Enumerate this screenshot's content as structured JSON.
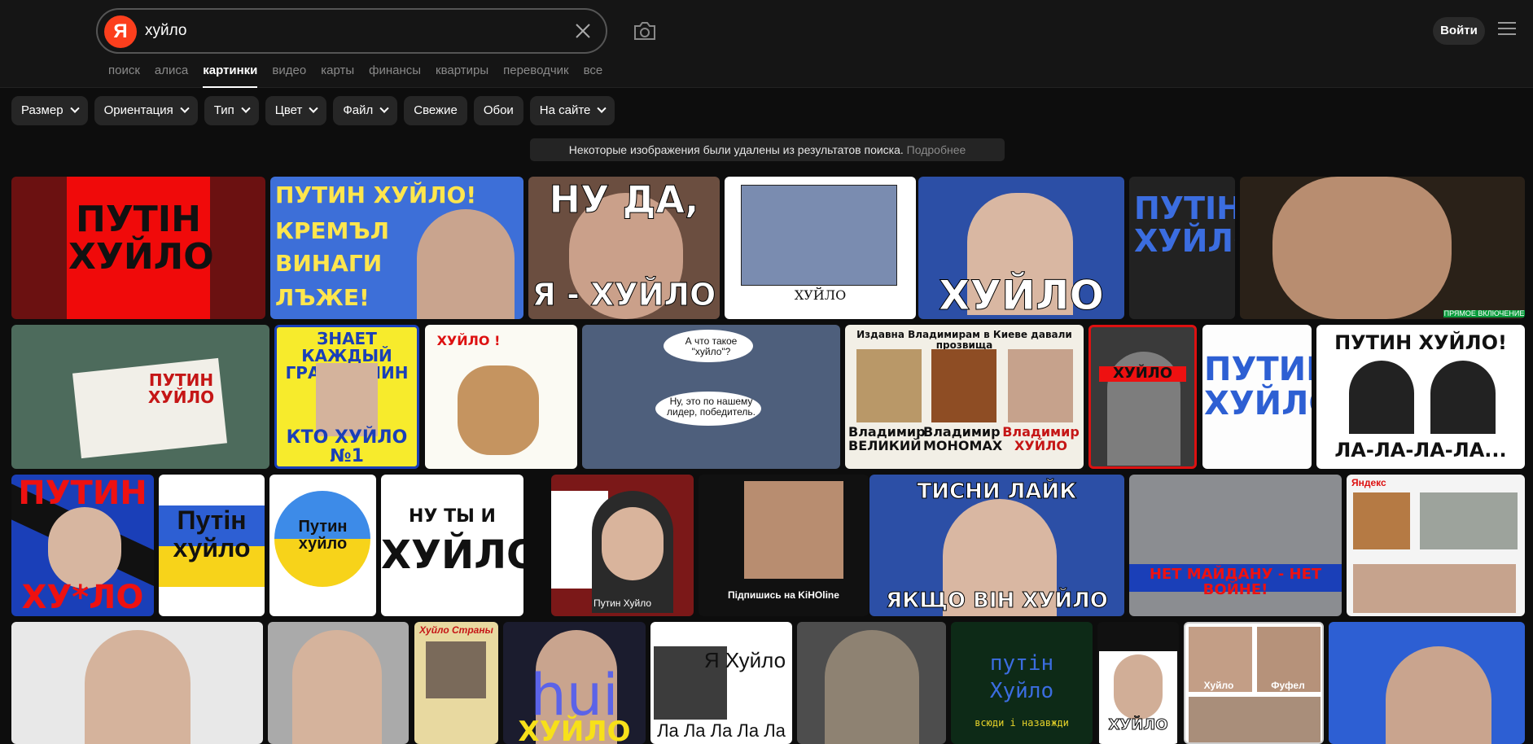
{
  "search": {
    "logo": "Я",
    "query": "хуйло",
    "clear_icon": "close-icon",
    "camera_icon": "camera-icon"
  },
  "header": {
    "login_label": "Войти",
    "menu_icon": "hamburger-icon"
  },
  "nav": {
    "items": [
      "поиск",
      "алиса",
      "картинки",
      "видео",
      "карты",
      "финансы",
      "квартиры",
      "переводчик",
      "все"
    ],
    "active": "картинки"
  },
  "filters": [
    "Размер",
    "Ориентация",
    "Тип",
    "Цвет",
    "Файл",
    "Свежие",
    "Обои",
    "На сайте"
  ],
  "notice": {
    "text": "Некоторые изображения были удалены из результатов поиска.",
    "link": "Подробнее"
  },
  "tiles": {
    "r1": {
      "a": "ПУТІН ХУЙЛО",
      "b1": "ПУТИН ХУЙЛО!",
      "b2": "КРЕМЪЛ",
      "b3": "ВИНАГИ",
      "b4": "ЛЪЖЕ!",
      "c1": "НУ ДА,",
      "c2": "Я - ХУЙЛО",
      "d": "ХУЙЛО",
      "e": "ХУЙЛО",
      "f": "ПУТІН ХУЙЛО",
      "g": "ПРЯМОЕ ВКЛЮЧЕНИЕ"
    },
    "r2": {
      "a": "ПУТИН ХУЙЛО",
      "b1": "ЗНАЕТ КАЖДЫЙ ГРАЖДАНИН",
      "b2": "КТО ХУЙЛО №1",
      "c": "ХУЙЛО !",
      "d1": "А что такое \"хуйло\"?",
      "d2": "Ну, это по нашему лидер, победитель.",
      "e1": "Издавна Владимирам в Киеве давали прозвища",
      "e2": "Владимир ВЕЛИКИЙ",
      "e3": "Владимир МОНОМАХ",
      "e4": "Владимир ХУЙЛО",
      "f": "ХУЙЛО",
      "g": "ПУТИН ХУЙЛО",
      "h1": "ПУТИН ХУЙЛО!",
      "h2": "ЛА-ЛА-ЛА-ЛА..."
    },
    "r3": {
      "a1": "ПУТИН",
      "a2": "ХУ*ЛО",
      "b": "Путін хуйло",
      "c": "Путин хуйло",
      "d1": "НУ ТЫ И",
      "d2": "ХУЙЛО",
      "e": "Путин Хуйло",
      "f": "Підпишись на KiHOline",
      "g1": "ТИСНИ ЛАЙК",
      "g2": "ЯКЩО ВІН ХУЙЛО",
      "h": "НЕТ МАЙДАНУ - НЕТ ВОЙНЕ!",
      "i": "Яндекс"
    },
    "r4": {
      "a": "Хуйло Страны",
      "b1": "hui",
      "b2": "ХУЙЛО",
      "c1": "Я Хуйло",
      "c2": "Ла Ла Ла Ла Ла",
      "d1": "путін",
      "d2": "Хуйло",
      "d3": "всюди і назавжди",
      "e": "ХУЙЛО",
      "f1": "Хуйло",
      "f2": "Фуфел"
    }
  },
  "colors": {
    "accent": "#fc3f1d",
    "bg": "#0d0d0d",
    "header": "#151515",
    "chip": "#262626"
  }
}
